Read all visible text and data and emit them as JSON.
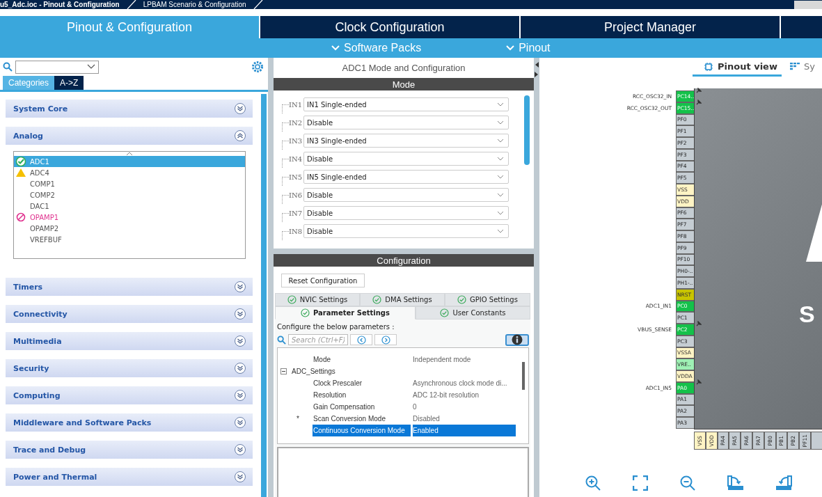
{
  "breadcrumbs": [
    {
      "label": "u5_Adc.ioc - Pinout & Configuration"
    },
    {
      "label": "LPBAM Scenario & Configuration"
    }
  ],
  "main_tabs": [
    {
      "label": "Pinout & Configuration",
      "selected": true
    },
    {
      "label": "Clock Configuration",
      "selected": false
    },
    {
      "label": "Project Manager",
      "selected": false
    }
  ],
  "sub_menus": [
    "Software Packs",
    "Pinout"
  ],
  "left_panel": {
    "view_tabs": [
      {
        "label": "Categories",
        "selected": true
      },
      {
        "label": "A->Z",
        "selected": false
      }
    ],
    "categories": [
      {
        "label": "System Core",
        "expanded": false
      },
      {
        "label": "Analog",
        "expanded": true,
        "items": [
          {
            "label": "ADC1",
            "kind": "ok",
            "selected": true
          },
          {
            "label": "ADC4",
            "kind": "warning",
            "selected": false
          },
          {
            "label": "COMP1",
            "kind": "plain",
            "selected": false
          },
          {
            "label": "COMP2",
            "kind": "plain",
            "selected": false
          },
          {
            "label": "DAC1",
            "kind": "plain",
            "selected": false
          },
          {
            "label": "OPAMP1",
            "kind": "blocked",
            "selected": false
          },
          {
            "label": "OPAMP2",
            "kind": "plain",
            "selected": false
          },
          {
            "label": "VREFBUF",
            "kind": "plain",
            "selected": false
          }
        ]
      },
      {
        "label": "Timers",
        "expanded": false
      },
      {
        "label": "Connectivity",
        "expanded": false
      },
      {
        "label": "Multimedia",
        "expanded": false
      },
      {
        "label": "Security",
        "expanded": false
      },
      {
        "label": "Computing",
        "expanded": false
      },
      {
        "label": "Middleware and Software Packs",
        "expanded": false
      },
      {
        "label": "Trace and Debug",
        "expanded": false
      },
      {
        "label": "Power and Thermal",
        "expanded": false
      }
    ]
  },
  "mode_panel": {
    "title": "ADC1 Mode and Configuration",
    "section": "Mode",
    "inputs": [
      {
        "label": "IN1",
        "value": "IN1 Single-ended"
      },
      {
        "label": "IN2",
        "value": "Disable"
      },
      {
        "label": "IN3",
        "value": "IN3 Single-ended"
      },
      {
        "label": "IN4",
        "value": "Disable"
      },
      {
        "label": "IN5",
        "value": "IN5 Single-ended"
      },
      {
        "label": "IN6",
        "value": "Disable"
      },
      {
        "label": "IN7",
        "value": "Disable"
      },
      {
        "label": "IN8",
        "value": "Disable"
      }
    ]
  },
  "config_panel": {
    "section": "Configuration",
    "reset_button": "Reset Configuration",
    "tab_rows": [
      [
        {
          "label": "NVIC Settings",
          "selected": false
        },
        {
          "label": "DMA Settings",
          "selected": false
        },
        {
          "label": "GPIO Settings",
          "selected": false
        }
      ],
      [
        {
          "label": "Parameter Settings",
          "selected": true
        },
        {
          "label": "User Constants",
          "selected": false
        }
      ]
    ],
    "hint": "Configure the below parameters :",
    "search_placeholder": "Search (Ctrl+F)",
    "parameters": [
      {
        "kind": "param",
        "name": "Mode",
        "value": "Independent mode",
        "selected": false
      },
      {
        "kind": "group",
        "name": "ADC_Settings",
        "expanded": true
      },
      {
        "kind": "param",
        "name": "Clock Prescaler",
        "value": "Asynchronous clock mode di...",
        "selected": false
      },
      {
        "kind": "param",
        "name": "Resolution",
        "value": "ADC 12-bit resolution",
        "selected": false
      },
      {
        "kind": "param",
        "name": "Gain Compensation",
        "value": "0",
        "selected": false
      },
      {
        "kind": "param",
        "name": "Scan Conversion Mode",
        "value": "Disabled",
        "selected": false,
        "marker": "*"
      },
      {
        "kind": "param",
        "name": "Continuous Conversion Mode",
        "value": "Enabled",
        "selected": true
      }
    ]
  },
  "pinout": {
    "view_tabs": [
      {
        "label": "Pinout view",
        "selected": true
      },
      {
        "label": "Sy",
        "selected": false
      }
    ],
    "chip_mark": "S",
    "left_pins": [
      {
        "name": "PC14..",
        "kind": "assigned",
        "signal": "RCC_OSC32_IN",
        "pinned": true
      },
      {
        "name": "PC15..",
        "kind": "assigned",
        "signal": "RCC_OSC32_OUT",
        "pinned": true
      },
      {
        "name": "PF0",
        "kind": "default"
      },
      {
        "name": "PF1",
        "kind": "default"
      },
      {
        "name": "PF2",
        "kind": "default"
      },
      {
        "name": "PF3",
        "kind": "default"
      },
      {
        "name": "PF4",
        "kind": "default"
      },
      {
        "name": "PF5",
        "kind": "default"
      },
      {
        "name": "VSS",
        "kind": "power"
      },
      {
        "name": "VDD",
        "kind": "power"
      },
      {
        "name": "PF6",
        "kind": "default"
      },
      {
        "name": "PF7",
        "kind": "default"
      },
      {
        "name": "PF8",
        "kind": "default"
      },
      {
        "name": "PF9",
        "kind": "default"
      },
      {
        "name": "PF10",
        "kind": "default"
      },
      {
        "name": "PH0-..",
        "kind": "default"
      },
      {
        "name": "PH1-..",
        "kind": "default"
      },
      {
        "name": "NRST",
        "kind": "reset"
      },
      {
        "name": "PC0",
        "kind": "assigned",
        "signal": "ADC1_IN1"
      },
      {
        "name": "PC1",
        "kind": "default"
      },
      {
        "name": "PC2",
        "kind": "assigned",
        "signal": "VBUS_SENSE",
        "pinned": true
      },
      {
        "name": "PC3",
        "kind": "default"
      },
      {
        "name": "VSSA",
        "kind": "power"
      },
      {
        "name": "VRE..",
        "kind": "vref"
      },
      {
        "name": "VDDA",
        "kind": "power"
      },
      {
        "name": "PA0",
        "kind": "assigned",
        "signal": "ADC1_IN5",
        "pinned": true
      },
      {
        "name": "PA1",
        "kind": "default"
      },
      {
        "name": "PA2",
        "kind": "default"
      },
      {
        "name": "PA3",
        "kind": "default"
      }
    ],
    "bottom_pins": [
      {
        "name": "VSS",
        "kind": "power"
      },
      {
        "name": "VDD",
        "kind": "power"
      },
      {
        "name": "PA4",
        "kind": "default"
      },
      {
        "name": "PA5",
        "kind": "default"
      },
      {
        "name": "PA6",
        "kind": "default"
      },
      {
        "name": "PA7",
        "kind": "default"
      },
      {
        "name": "PB0",
        "kind": "default"
      },
      {
        "name": "PB1",
        "kind": "default"
      },
      {
        "name": "PB2",
        "kind": "default"
      },
      {
        "name": "PF11",
        "kind": "default"
      }
    ]
  }
}
